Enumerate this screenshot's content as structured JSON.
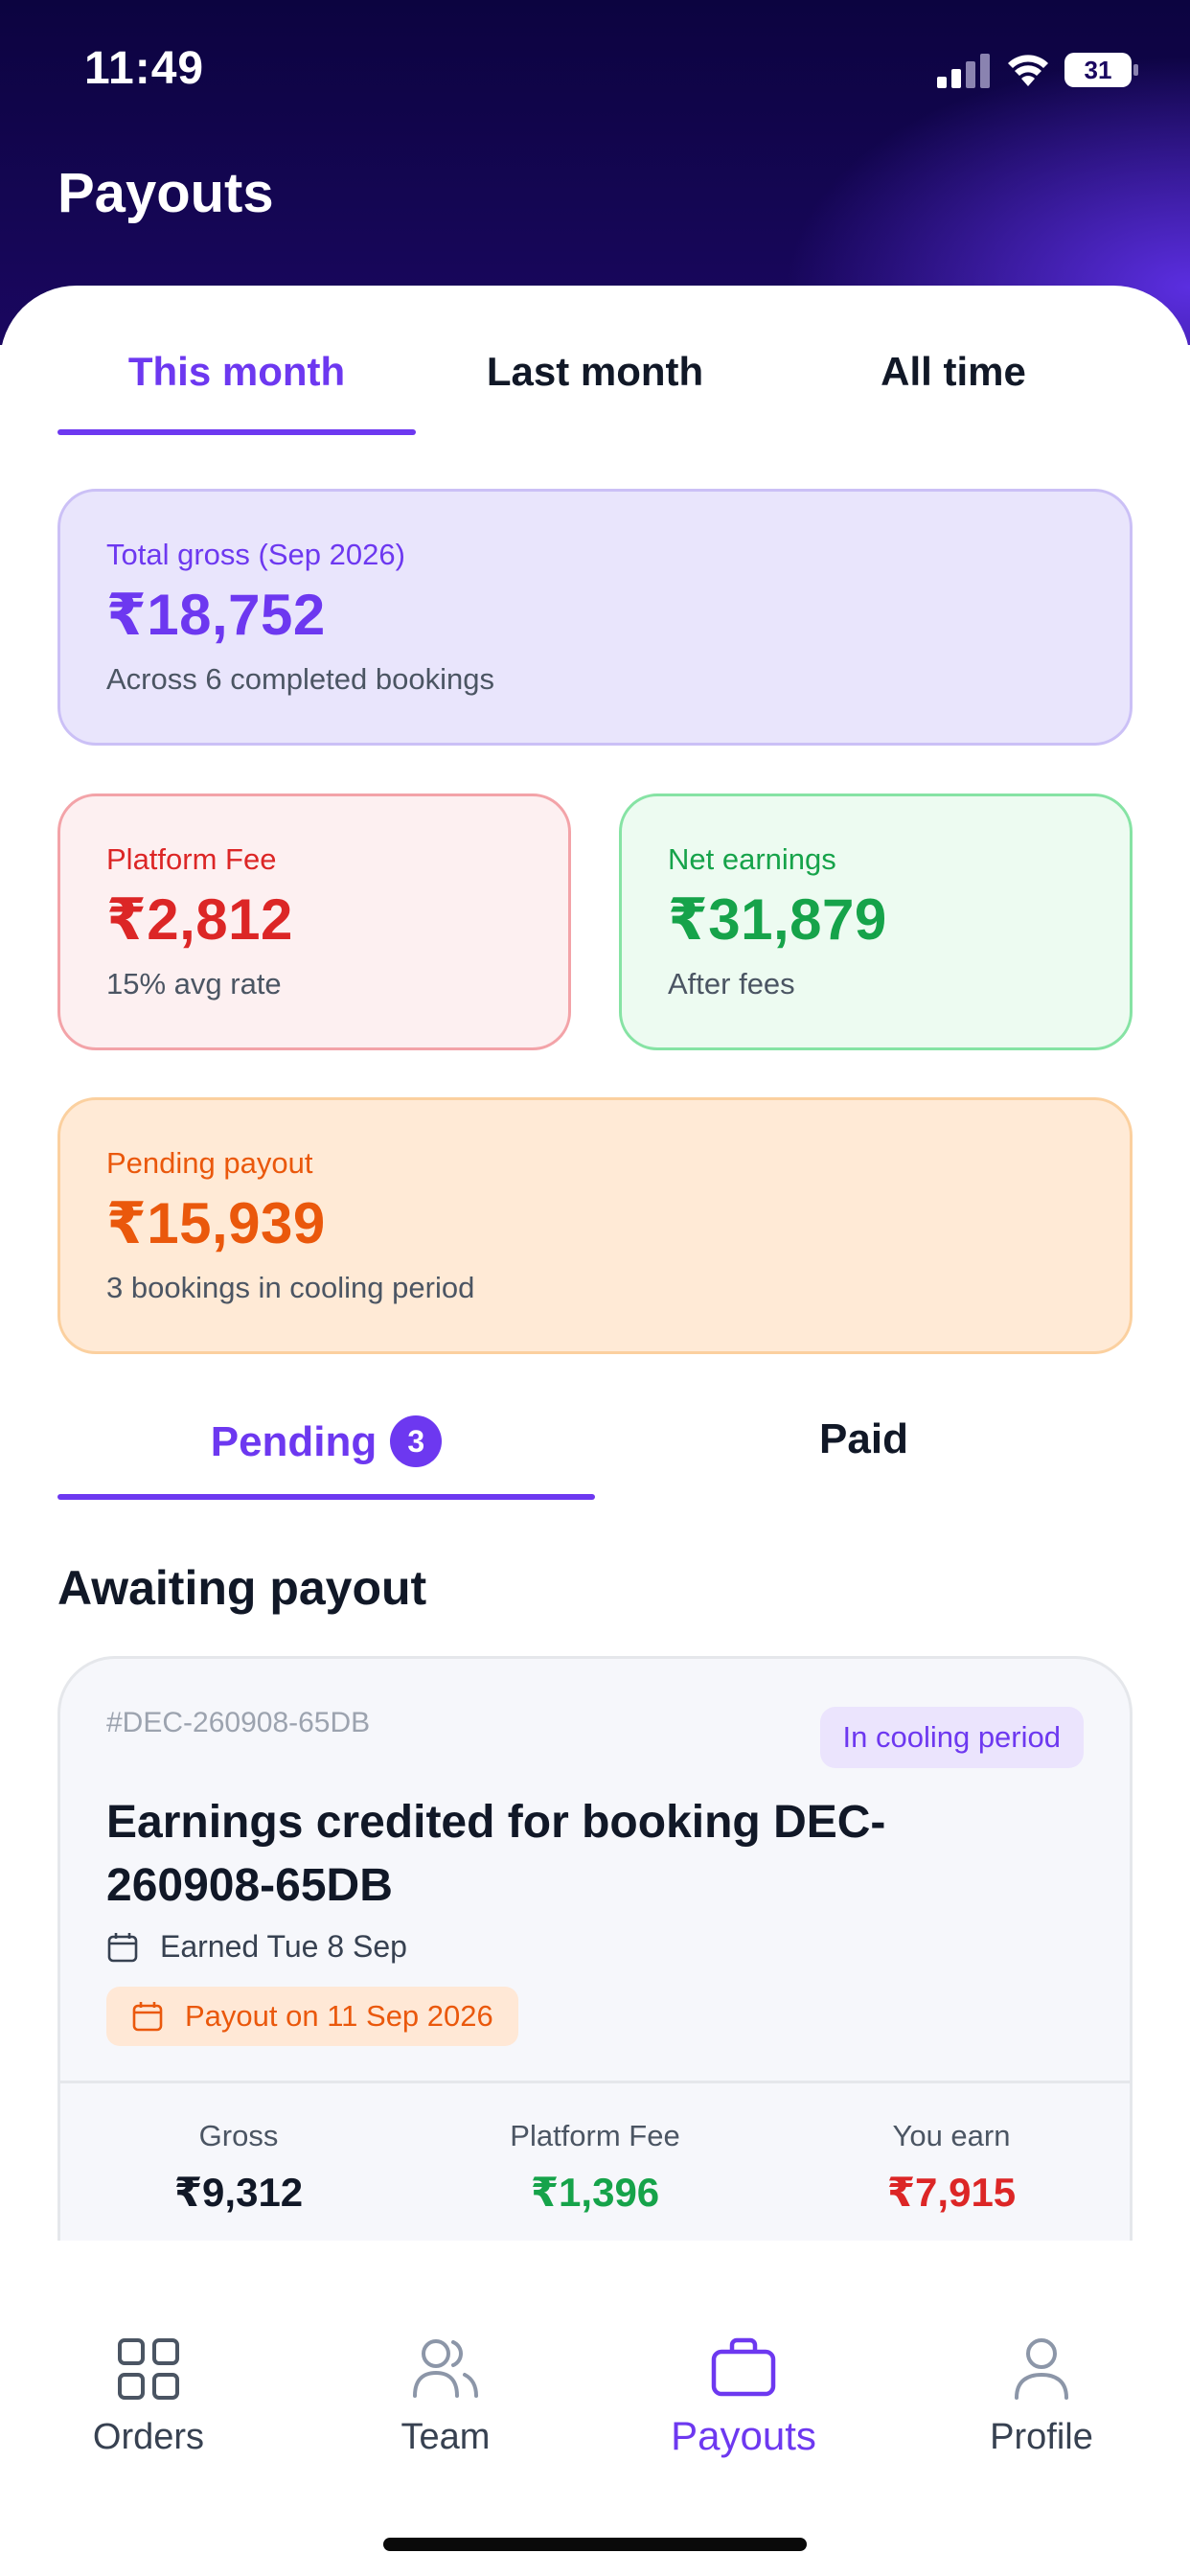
{
  "status_bar": {
    "time": "11:49",
    "battery": "31"
  },
  "header": {
    "title": "Payouts"
  },
  "period_tabs": [
    {
      "label": "This month",
      "active": true
    },
    {
      "label": "Last month",
      "active": false
    },
    {
      "label": "All time",
      "active": false
    }
  ],
  "summary": {
    "gross": {
      "label": "Total gross (Sep 2026)",
      "value": "₹18,752",
      "sub": "Across 6 completed bookings"
    },
    "fee": {
      "label": "Platform Fee",
      "value": "₹2,812",
      "sub": "15% avg rate"
    },
    "net": {
      "label": "Net earnings",
      "value": "₹31,879",
      "sub": "After fees"
    },
    "pending": {
      "label": "Pending payout",
      "value": "₹15,939",
      "sub": "3 bookings in cooling period"
    }
  },
  "status_tabs": {
    "pending": {
      "label": "Pending",
      "count": "3"
    },
    "paid": {
      "label": "Paid"
    }
  },
  "section_title": "Awaiting payout",
  "booking": {
    "id": "#DEC-260908-65DB",
    "status": "In cooling period",
    "title": "Earnings credited for booking DEC-260908-65DB",
    "earned": "Earned Tue 8 Sep",
    "payout_date": "Payout on 11 Sep 2026",
    "amounts": [
      {
        "label": "Gross",
        "value": "₹9,312",
        "color": "#111827"
      },
      {
        "label": "Platform Fee",
        "value": "₹1,396",
        "color": "#16a34a"
      },
      {
        "label": "You earn",
        "value": "₹7,915",
        "color": "#dc2626"
      }
    ]
  },
  "nav": {
    "orders": "Orders",
    "team": "Team",
    "payouts": "Payouts",
    "profile": "Profile",
    "active": "payouts"
  },
  "colors": {
    "accent": "#6d38f0",
    "danger": "#dc2626",
    "success": "#16a34a",
    "warning": "#ea580c"
  }
}
